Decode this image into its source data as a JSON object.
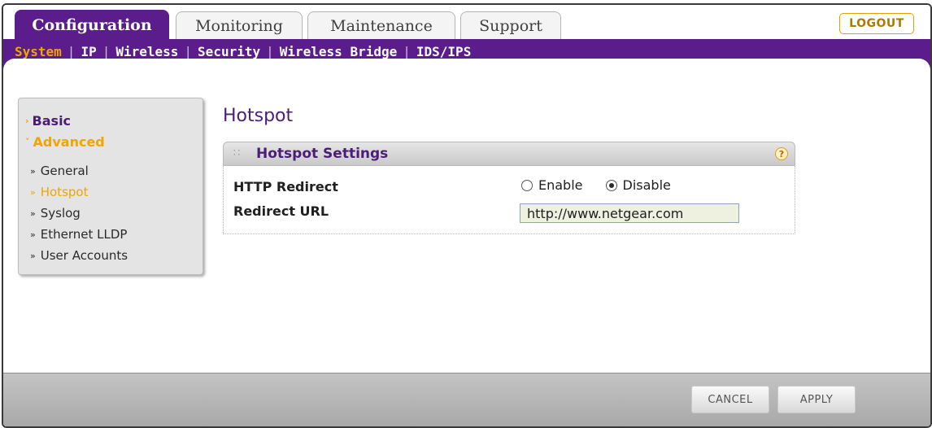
{
  "tabs": [
    {
      "label": "Configuration",
      "active": true
    },
    {
      "label": "Monitoring",
      "active": false
    },
    {
      "label": "Maintenance",
      "active": false
    },
    {
      "label": "Support",
      "active": false
    }
  ],
  "logout_label": "LOGOUT",
  "submenu": [
    {
      "label": "System",
      "active": true
    },
    {
      "label": "IP",
      "active": false
    },
    {
      "label": "Wireless",
      "active": false
    },
    {
      "label": "Security",
      "active": false
    },
    {
      "label": "Wireless Bridge",
      "active": false
    },
    {
      "label": "IDS/IPS",
      "active": false
    }
  ],
  "sidebar": {
    "sections": [
      {
        "label": "Basic",
        "expanded": false
      },
      {
        "label": "Advanced",
        "expanded": true
      }
    ],
    "items": [
      {
        "label": "General",
        "active": false
      },
      {
        "label": "Hotspot",
        "active": true
      },
      {
        "label": "Syslog",
        "active": false
      },
      {
        "label": "Ethernet LLDP",
        "active": false
      },
      {
        "label": "User Accounts",
        "active": false
      }
    ]
  },
  "page_title": "Hotspot",
  "panel": {
    "title": "Hotspot Settings",
    "help_icon": "help-icon",
    "http_redirect": {
      "label": "HTTP Redirect",
      "options": [
        {
          "label": "Enable",
          "selected": false
        },
        {
          "label": "Disable",
          "selected": true
        }
      ]
    },
    "redirect_url": {
      "label": "Redirect URL",
      "value": "http://www.netgear.com"
    }
  },
  "footer": {
    "cancel_label": "CANCEL",
    "apply_label": "APPLY"
  },
  "colors": {
    "brand_purple": "#5b1d8c",
    "accent_orange": "#f0a500"
  }
}
